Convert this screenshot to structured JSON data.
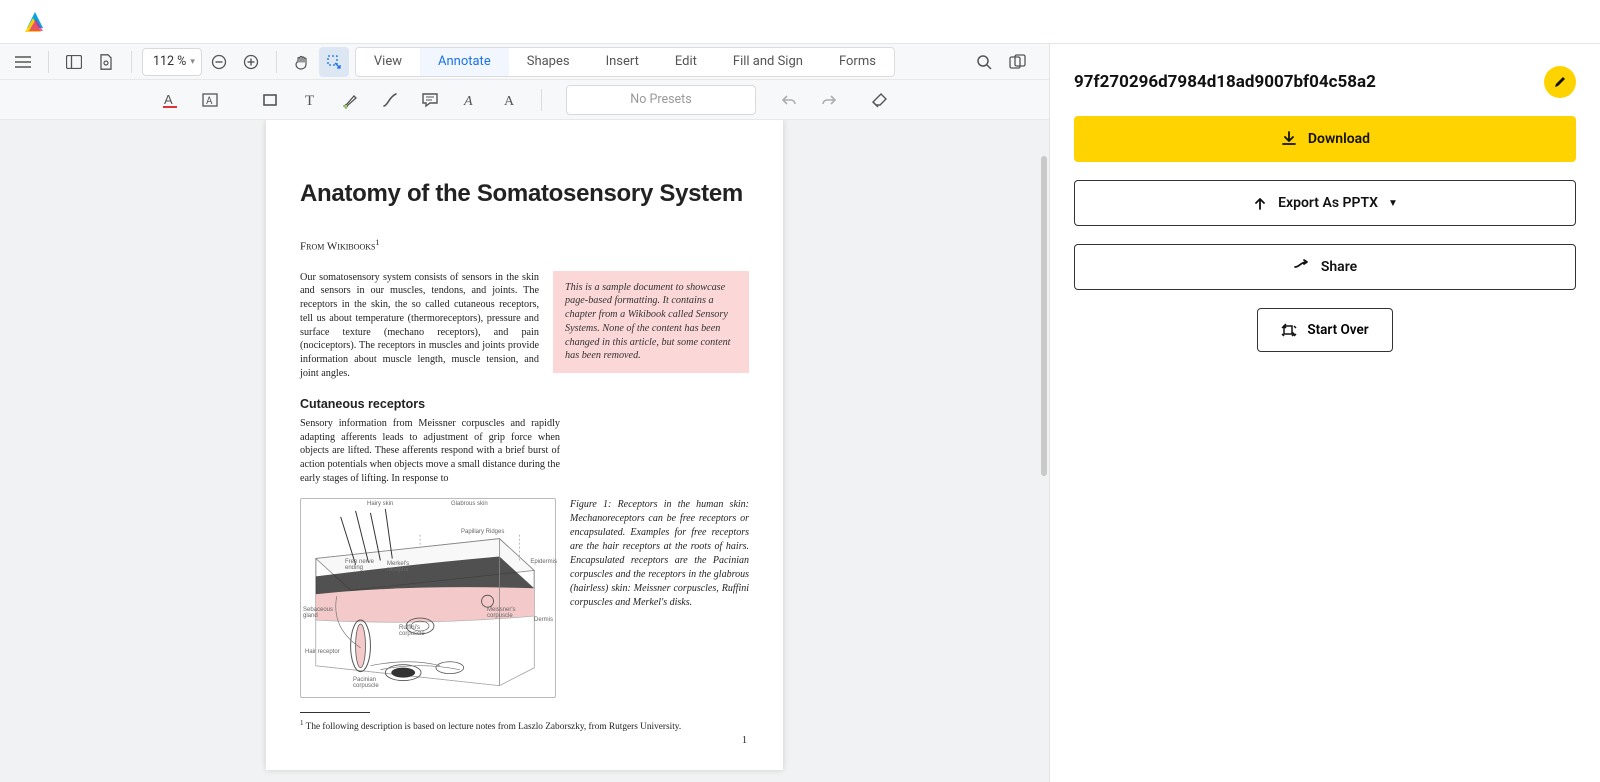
{
  "zoom_label": "112 %",
  "tabs": {
    "view": "View",
    "annotate": "Annotate",
    "shapes": "Shapes",
    "insert": "Insert",
    "edit": "Edit",
    "fillsign": "Fill and Sign",
    "forms": "Forms"
  },
  "preset_label": "No Presets",
  "sidebar": {
    "doc_title": "97f270296d7984d18ad9007bf04c58a2",
    "download": "Download",
    "export": "Export As PPTX",
    "share": "Share",
    "startover": "Start Over"
  },
  "doc": {
    "title": "Anatomy of the Somatosensory System",
    "source_pre": "From Wikibooks",
    "source_sup": "1",
    "para1": "Our somatosensory system consists of sensors in the skin and sensors in our muscles, tendons, and joints. The receptors in the skin, the so called cutaneous receptors, tell us about temperature (thermoreceptors), pressure and surface texture (mechano receptors), and pain (nociceptors). The receptors in muscles and joints provide information about muscle length, muscle tension, and joint angles.",
    "notebox": "This is a sample document to showcase page-based formatting. It contains a chapter from a Wikibook called Sensory Systems. None of the content has been changed in this article, but some content has been removed.",
    "h2": "Cutaneous receptors",
    "para2": "Sensory information from Meissner corpuscles and rapidly adapting afferents leads to adjustment of grip force when objects are lifted. These afferents respond with a brief burst of action potentials when objects move a small distance during the early stages of lifting. In response to",
    "fig_caption": "Figure 1:  Receptors in the human skin: Mechanoreceptors can be free receptors or encapsulated. Examples for free receptors are the hair receptors at the roots of hairs. Encapsulated receptors are the Pacinian corpuscles and the receptors in the glabrous (hairless) skin: Meissner corpuscles, Ruffini corpuscles and Merkel's disks.",
    "figlabels": {
      "hairy": "Hairy skin",
      "glab": "Glabrous skin",
      "pap": "Papillary Ridges",
      "epi": "Epidermis",
      "dermis": "Dermis",
      "merkel": "Merkel's receptor",
      "nerve": "Free nerve ending",
      "seb": "Sebaceous gland",
      "meiss": "Meissner's corpuscle",
      "ruff": "Ruffini's corpuscle",
      "hair": "Hair receptor",
      "pac": "Pacinian corpuscle"
    },
    "footnote_sup": "1",
    "footnote": " The following description is based on lecture notes from Laszlo Zaborszky, from Rutgers University.",
    "pagenum": "1"
  }
}
